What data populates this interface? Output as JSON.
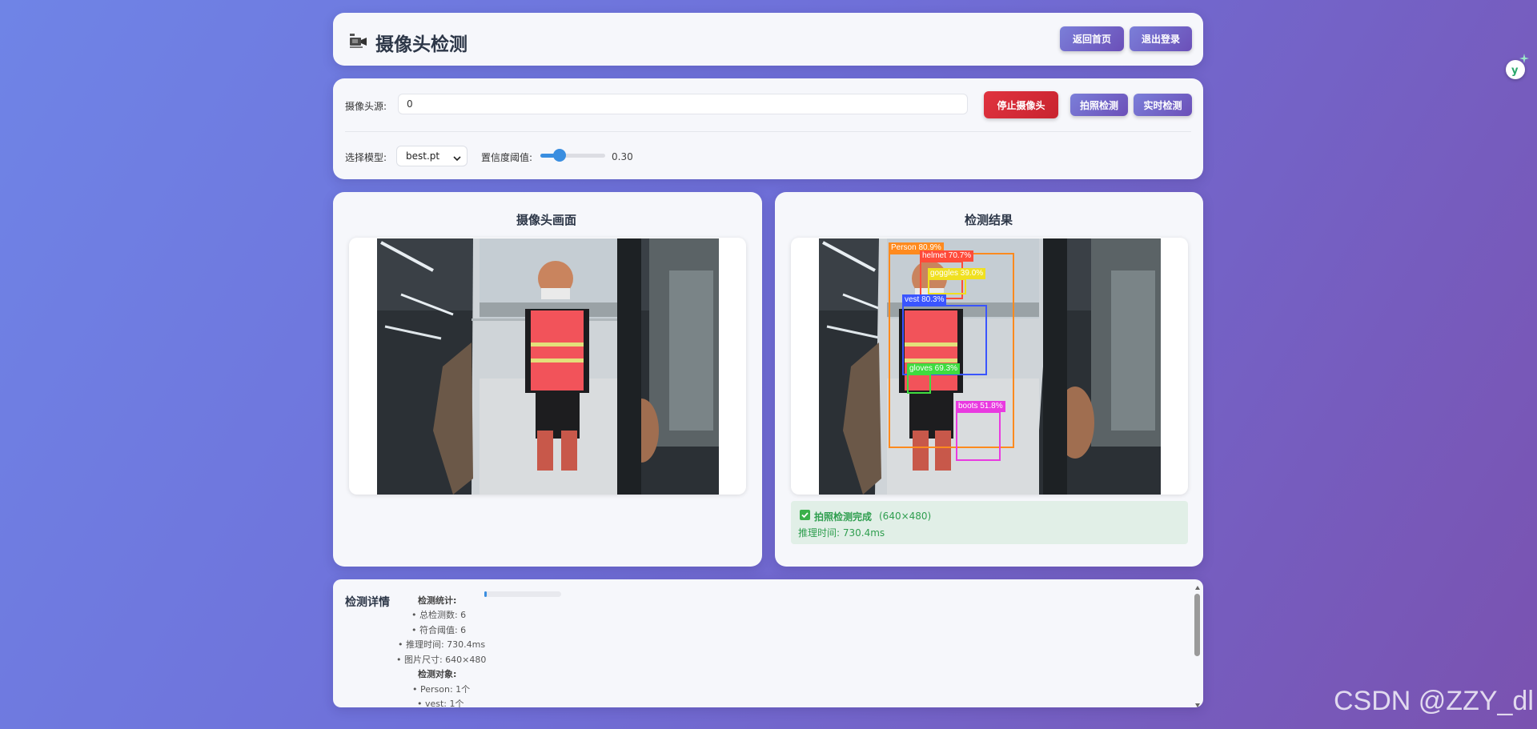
{
  "header": {
    "icon": "video-camera-icon",
    "title": "摄像头检测",
    "home_label": "返回首页",
    "logout_label": "退出登录"
  },
  "controls": {
    "source_label": "摄像头源:",
    "source_value": "0",
    "stop_label": "停止摄像头",
    "photo_label": "拍照检测",
    "realtime_label": "实时检测",
    "model_label": "选择模型:",
    "model_value": "best.pt",
    "conf_label": "置信度阈值:",
    "conf_value": "0.30",
    "conf_fraction": 0.3
  },
  "camera_panel": {
    "title": "摄像头画面"
  },
  "result_panel": {
    "title": "检测结果",
    "status_title": "拍照检测完成",
    "status_size": "(640×480)",
    "infer_time": "推理时间: 730.4ms",
    "detections": [
      {
        "label": "Person 80.9%",
        "color": "#ff8a1e"
      },
      {
        "label": "helmet 70.7%",
        "color": "#ff4b3a"
      },
      {
        "label": "goggles 39.0%",
        "color": "#f0e020"
      },
      {
        "label": "vest 80.3%",
        "color": "#3a55ff"
      },
      {
        "label": "gloves 69.3%",
        "color": "#3fdc3f"
      },
      {
        "label": "boots 51.8%",
        "color": "#e93ae0"
      }
    ]
  },
  "details": {
    "title": "检测详情",
    "stats_heading": "检测统计:",
    "lines": [
      "• 总检测数: 6",
      "• 符合阈值: 6",
      "• 推理时间: 730.4ms",
      "• 图片尺寸: 640×480"
    ],
    "objects_heading": "检测对象:",
    "objects": [
      "• Person: 1个",
      "• vest: 1个"
    ]
  },
  "watermark": "CSDN @ZZY_dl",
  "colors": {
    "accent": "#6b4fb8",
    "danger": "#c8232f",
    "success": "#2f9e4f"
  }
}
